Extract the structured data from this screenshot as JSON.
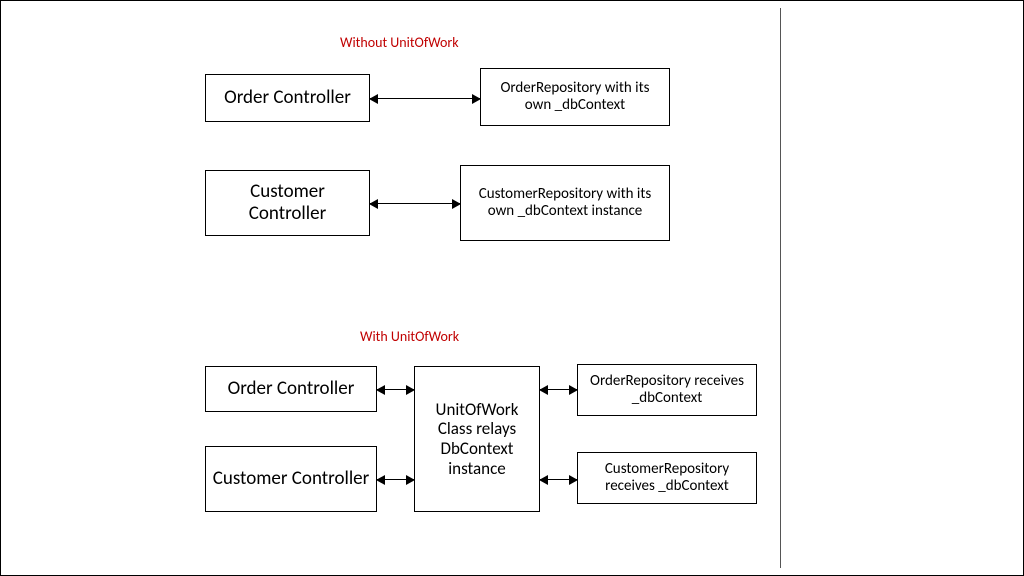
{
  "titles": {
    "without": "Without UnitOfWork",
    "with": "With UnitOfWork"
  },
  "without": {
    "orderController": "Order Controller",
    "orderRepo": "OrderRepository with its own _dbContext",
    "customerController": "Customer Controller",
    "customerRepo": "CustomerRepository with its own _dbContext instance"
  },
  "with": {
    "orderController": "Order Controller",
    "customerController": "Customer Controller",
    "uow": "UnitOfWork Class relays DbContext instance",
    "orderRepo": "OrderRepository receives _dbContext",
    "customerRepo": "CustomerRepository receives _dbContext"
  }
}
